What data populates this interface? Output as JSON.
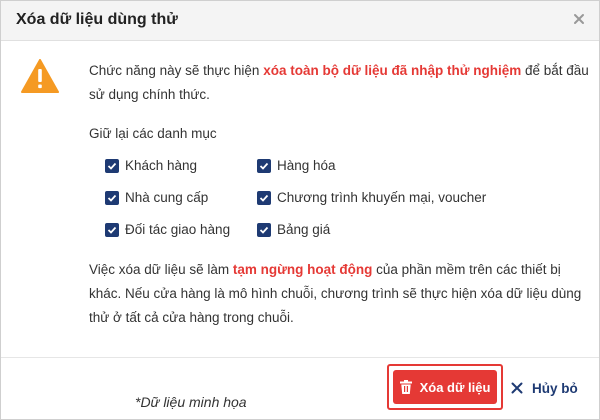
{
  "dialog": {
    "title": "Xóa dữ liệu dùng thử",
    "close_icon": "close-icon"
  },
  "intro": {
    "before": "Chức năng này sẽ thực hiện ",
    "highlight": "xóa toàn bộ dữ liệu đã nhập thử nghiệm",
    "after": " để bắt đầu sử dụng chính thức."
  },
  "keep": {
    "label": "Giữ lại các danh mục",
    "items": [
      {
        "label": "Khách hàng",
        "checked": true
      },
      {
        "label": "Hàng hóa",
        "checked": true
      },
      {
        "label": "Nhà cung cấp",
        "checked": true
      },
      {
        "label": "Chương trình khuyến mại, voucher",
        "checked": true
      },
      {
        "label": "Đối tác giao hàng",
        "checked": true
      },
      {
        "label": "Bảng giá",
        "checked": true
      }
    ]
  },
  "note": {
    "before": "Việc xóa dữ liệu sẽ làm ",
    "highlight": "tạm ngừng hoạt động",
    "after": " của phần mềm trên các thiết bị khác. Nếu cửa hàng là mô hình chuỗi, chương trình sẽ thực hiện xóa dữ liệu dùng thử ở tất cả cửa hàng trong chuỗi."
  },
  "footer": {
    "demo_note": "*Dữ liệu minh họa",
    "delete_label": "Xóa dữ liệu",
    "cancel_label": "Hủy bỏ"
  },
  "colors": {
    "accent_red": "#e53935",
    "navy": "#1e3a73",
    "warning_orange": "#f59a23"
  }
}
